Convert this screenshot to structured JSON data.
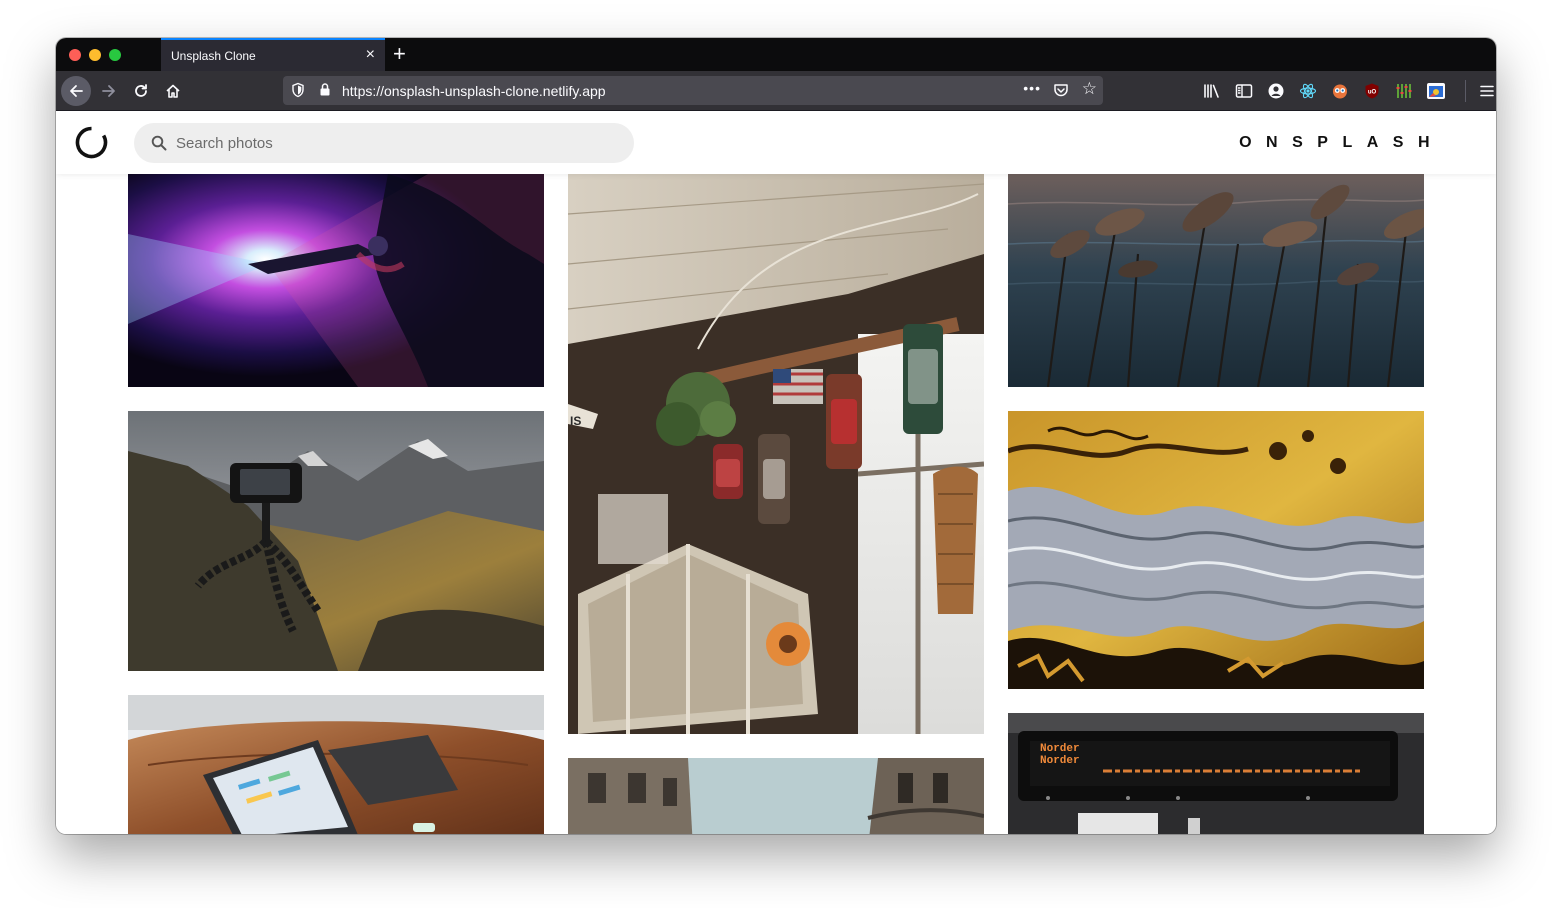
{
  "browser": {
    "tab_title": "Unsplash Clone",
    "tab_close": "×",
    "new_tab": "+",
    "url": "https://onsplash-unsplash-clone.netlify.app",
    "url_menu": "•••"
  },
  "header": {
    "search_placeholder": "Search photos",
    "brand": "ONSPLASH"
  },
  "photos": [
    {
      "subject": "projector-light"
    },
    {
      "subject": "mountain-tripod-phone"
    },
    {
      "subject": "laptop-on-leather-sofa"
    },
    {
      "subject": "hanging-lanterns-shop"
    },
    {
      "subject": "city-street-buildings"
    },
    {
      "subject": "reeds-by-water"
    },
    {
      "subject": "fluid-art-marble"
    },
    {
      "subject": "led-departure-board"
    }
  ],
  "photo_text": {
    "shop_sign": "IS",
    "board_line": "Norder"
  }
}
